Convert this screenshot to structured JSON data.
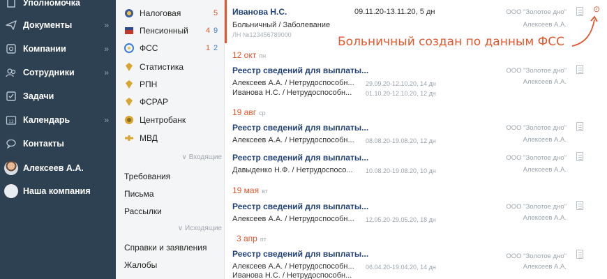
{
  "colors": {
    "sidebar_bg": "#2e4152",
    "accent": "#e4572e",
    "link_blue": "#22417a"
  },
  "sidebar": {
    "items": [
      {
        "label": "Уполномочка",
        "icon": "power-of-attorney-icon",
        "chevron": ""
      },
      {
        "label": "Документы",
        "icon": "paper-plane-icon",
        "chevron": "»"
      },
      {
        "label": "Компании",
        "icon": "company-icon",
        "chevron": "»"
      },
      {
        "label": "Сотрудники",
        "icon": "people-icon",
        "chevron": "»"
      },
      {
        "label": "Задачи",
        "icon": "checkbox-icon",
        "chevron": ""
      },
      {
        "label": "Календарь",
        "icon": "calendar-icon",
        "chevron": "»"
      },
      {
        "label": "Контакты",
        "icon": "chat-icon",
        "chevron": ""
      },
      {
        "label": "Алексеев А.А.",
        "icon": "avatar",
        "chevron": ""
      },
      {
        "label": "Наша компания",
        "icon": "company-avatar",
        "chevron": ""
      }
    ]
  },
  "orgs": [
    {
      "label": "Налоговая",
      "icon": "tax-emblem-icon",
      "count_red": "5",
      "count_blue": ""
    },
    {
      "label": "Пенсионный",
      "icon": "pension-emblem-icon",
      "count_red": "4",
      "count_blue": "9"
    },
    {
      "label": "ФСС",
      "icon": "fss-emblem-icon",
      "count_red": "1",
      "count_blue": "2"
    },
    {
      "label": "Статистика",
      "icon": "stats-emblem-icon",
      "count_red": "",
      "count_blue": ""
    },
    {
      "label": "РПН",
      "icon": "rpn-emblem-icon",
      "count_red": "",
      "count_blue": ""
    },
    {
      "label": "ФСРАР",
      "icon": "fsrar-emblem-icon",
      "count_red": "",
      "count_blue": ""
    },
    {
      "label": "Центробанк",
      "icon": "centrobank-emblem-icon",
      "count_red": "",
      "count_blue": ""
    },
    {
      "label": "МВД",
      "icon": "mvd-emblem-icon",
      "count_red": "",
      "count_blue": ""
    }
  ],
  "incoming_label": "Входящие",
  "incoming_links": [
    "Требования",
    "Письма",
    "Рассылки"
  ],
  "outgoing_label": "Исходящие",
  "outgoing_links": [
    "Справки и заявления",
    "Жалобы"
  ],
  "main": {
    "top": {
      "name": "Иванова Н.С.",
      "period": "09.11.20-13.11.20, 5 дн",
      "type": "Больничный / Заболевание",
      "number": "ЛН №123456789000",
      "org": "ООО \"Золотое дно\"",
      "person": "Алексеев А.А."
    },
    "annotation": "Больничный создан по данным ФСС",
    "groups": [
      {
        "day": "12 окт",
        "weekday": "пн",
        "entries": [
          {
            "title": "Реестр сведений для выплаты...",
            "org": "ООО \"Золотое дно\"",
            "person": "Алексеев А.А.",
            "lines": [
              {
                "text": "Алексеев А.А. / Нетрудоспособн...",
                "period": "29.09.20-12.10.20, 14 дн"
              },
              {
                "text": "Иванова Н.С. / Нетрудоспособн...",
                "period": "01.10.20-12.10.20, 12 дн"
              }
            ]
          }
        ]
      },
      {
        "day": "19 авг",
        "weekday": "ср",
        "entries": [
          {
            "title": "Реестр сведений для выплаты...",
            "org": "ООО \"Золотое дно\"",
            "person": "Алексеев А.А.",
            "lines": [
              {
                "text": "Алексеев А.А. / Нетрудоспособн...",
                "period": "08.08.20-19.08.20, 12 дн"
              }
            ]
          },
          {
            "title": "Реестр сведений для выплаты...",
            "org": "ООО \"Золотое дно\"",
            "person": "Алексеев А.А.",
            "lines": [
              {
                "text": "Давыденко Н.Ф. / Нетрудоспосо...",
                "period": "10.08.20-19.08.20, 10 дн"
              }
            ]
          }
        ]
      },
      {
        "day": "19 мая",
        "weekday": "вт",
        "entries": [
          {
            "title": "Реестр сведений для выплаты...",
            "org": "ООО \"Золотое дно\"",
            "person": "Алексеев А.А.",
            "lines": [
              {
                "text": "Алексеев А.А. / Нетрудоспособн...",
                "period": "12.05.20-29.05.20, 18 дн"
              }
            ]
          }
        ]
      },
      {
        "day": "3 апр",
        "weekday": "пт",
        "entries": [
          {
            "title": "Реестр сведений для выплаты...",
            "org": "ООО \"Золотое дно\"",
            "person": "Алексеев А.А.",
            "lines": [
              {
                "text": "Алексеев А.А. / Нетрудоспособн...",
                "period": "06.04.20-19.04.20, 14 дн"
              },
              {
                "text": "Иванова Н.С. / Нетрудоспособн...",
                "period": ""
              }
            ]
          }
        ]
      }
    ]
  }
}
